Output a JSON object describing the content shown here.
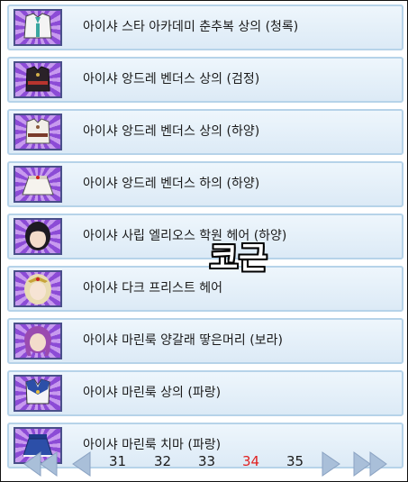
{
  "items": [
    {
      "label": "아이샤 스타 아카데미 춘추복 상의 (청록)",
      "icon": "academy-uniform-top-icon"
    },
    {
      "label": "아이샤 앙드레 벤더스 상의 (검정)",
      "icon": "black-top-icon"
    },
    {
      "label": "아이샤 앙드레 벤더스 상의 (하양)",
      "icon": "white-top-icon"
    },
    {
      "label": "아이샤 앙드레 벤더스 하의 (하양)",
      "icon": "white-skirt-icon"
    },
    {
      "label": "아이샤 사립 엘리오스 학원 헤어 (하양)",
      "icon": "school-hair-icon"
    },
    {
      "label": "아이샤 다크 프리스트 헤어",
      "icon": "dark-priest-hair-icon"
    },
    {
      "label": "아이샤 마린룩 양갈래 땋은머리 (보라)",
      "icon": "braided-hair-icon"
    },
    {
      "label": "아이샤 마린룩 상의 (파랑)",
      "icon": "marine-top-icon"
    },
    {
      "label": "아이샤 마린룩 치마 (파랑)",
      "icon": "marine-skirt-icon"
    }
  ],
  "watermark": "코근",
  "pagination": {
    "pages": [
      "31",
      "32",
      "33",
      "34",
      "35"
    ],
    "current": "34"
  },
  "colors": {
    "row_border": "#b6d3e9",
    "current_page": "#e02020",
    "thumb_purple": "#8c4bd6"
  }
}
